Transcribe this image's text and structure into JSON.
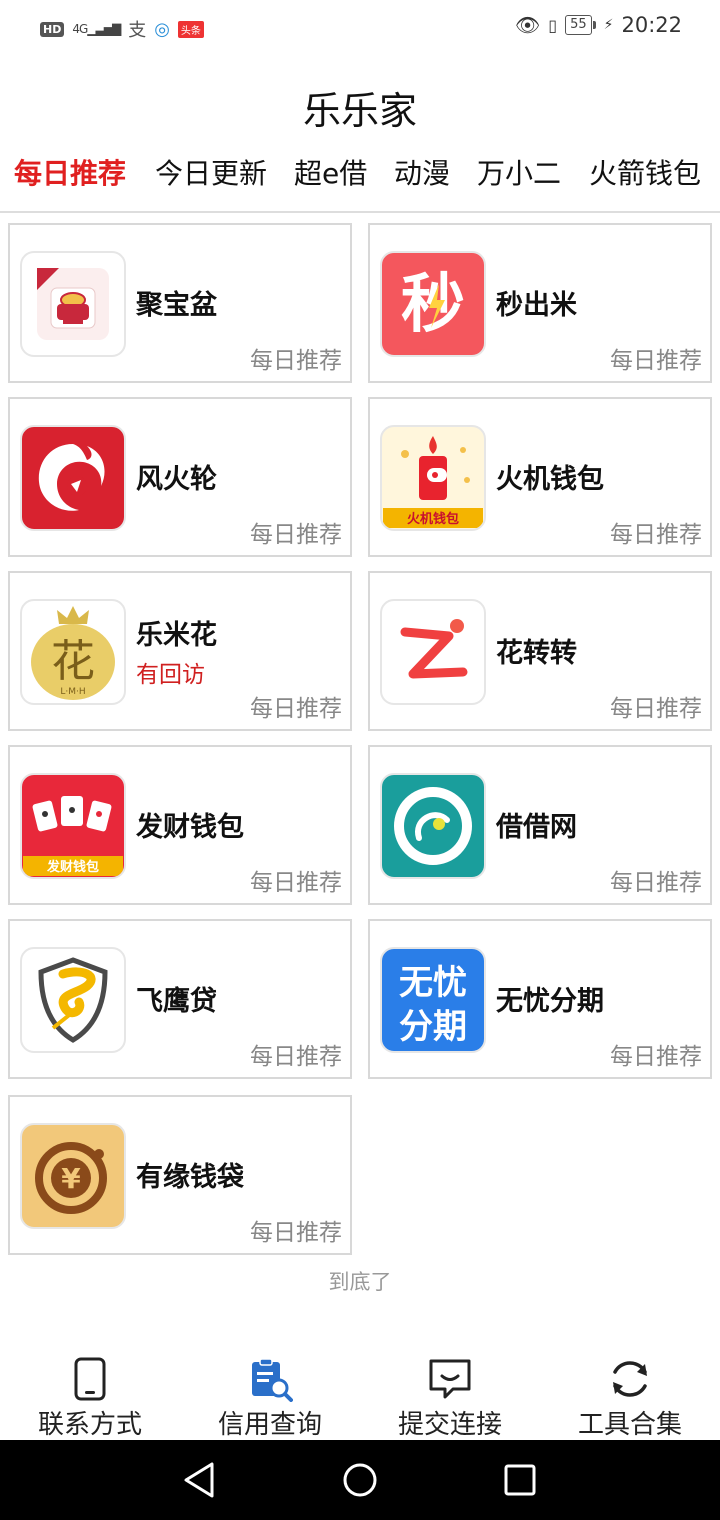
{
  "status_bar": {
    "hd": "HD",
    "network": "4G",
    "alipay_glyph": "支",
    "toutiao": "头条",
    "battery": "55",
    "time": "20:22"
  },
  "header": {
    "title": "乐乐家"
  },
  "tabs": [
    {
      "label": "每日推荐",
      "active": true
    },
    {
      "label": "今日更新"
    },
    {
      "label": "超e借"
    },
    {
      "label": "动漫"
    },
    {
      "label": "万小二"
    },
    {
      "label": "火箭钱包"
    }
  ],
  "apps": [
    {
      "name": "聚宝盆",
      "tag": "每日推荐",
      "icon": "treasure-bowl-icon"
    },
    {
      "name": "秒出米",
      "tag": "每日推荐",
      "icon": "miao-icon",
      "icon_text": "秒"
    },
    {
      "name": "风火轮",
      "tag": "每日推荐",
      "icon": "fire-wheel-icon"
    },
    {
      "name": "火机钱包",
      "tag": "每日推荐",
      "icon": "lighter-wallet-icon",
      "icon_text": "火机钱包"
    },
    {
      "name": "乐米花",
      "note": "有回访",
      "tag": "每日推荐",
      "icon": "lemihua-icon",
      "icon_text": "花",
      "icon_sub": "L·M·H"
    },
    {
      "name": "花转转",
      "tag": "每日推荐",
      "icon": "huazhuanzhuan-icon"
    },
    {
      "name": "发财钱包",
      "tag": "每日推荐",
      "icon": "facai-wallet-icon",
      "icon_text": "发财钱包"
    },
    {
      "name": "借借网",
      "tag": "每日推荐",
      "icon": "jiejie-icon"
    },
    {
      "name": "飞鹰贷",
      "tag": "每日推荐",
      "icon": "eagle-loan-icon"
    },
    {
      "name": "无忧分期",
      "tag": "每日推荐",
      "icon": "wuyou-icon",
      "icon_text_top": "无忧",
      "icon_text_bottom": "分期"
    },
    {
      "name": "有缘钱袋",
      "tag": "每日推荐",
      "icon": "yuan-coin-icon",
      "icon_text": "¥"
    }
  ],
  "end_text": "到底了",
  "bottom_nav": [
    {
      "label": "联系方式",
      "icon": "phone-icon"
    },
    {
      "label": "信用查询",
      "icon": "credit-search-icon"
    },
    {
      "label": "提交连接",
      "icon": "message-icon"
    },
    {
      "label": "工具合集",
      "icon": "refresh-icon"
    }
  ],
  "colors": {
    "accent": "#e02020",
    "divider": "#d8d8d8",
    "tag_gray": "#888888"
  }
}
